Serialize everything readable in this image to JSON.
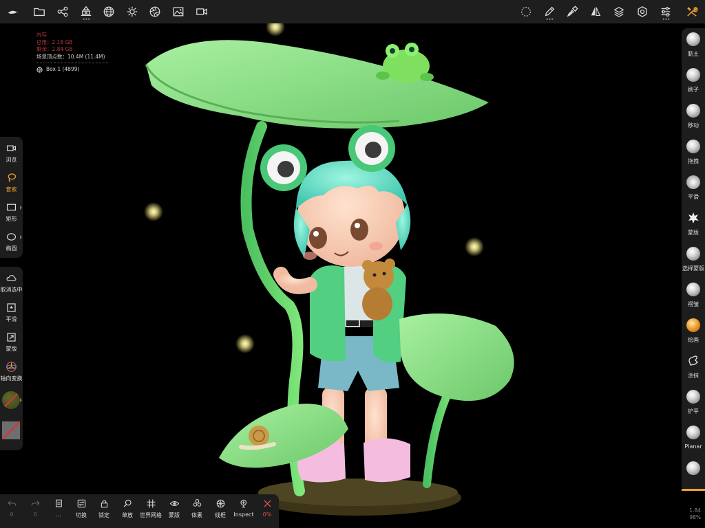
{
  "info": {
    "memory_title": "内存",
    "used": "已用：2.18 GB",
    "remaining": "剩余：2.84 GB",
    "vertices": "场景顶点数：10.4M (11.4M)",
    "selected_object": "Box 1 (4899)"
  },
  "left_tools": {
    "browse": "浏览",
    "lasso": "套索",
    "rectangle": "矩形",
    "ellipse": "椭圆",
    "deselect": "取消选中",
    "smooth": "平滑",
    "mask": "蒙版",
    "axis_transform": "轴向变换"
  },
  "right_tools": {
    "clay": "黏土",
    "brush": "刷子",
    "move": "移动",
    "drag": "拖拽",
    "smooth": "平滑",
    "mask": "蒙版",
    "select_mask": "选择蒙版",
    "crease": "褶皱",
    "paint": "绘画",
    "smudge": "涂抹",
    "flatten": "铲平",
    "planar": "Planar"
  },
  "bottom_tools": {
    "undo_count": "0",
    "redo_count": "0",
    "menu_dots": "...",
    "switch": "切换",
    "lock": "锁定",
    "solo": "单放",
    "world_grid": "世界网格",
    "mask": "蒙版",
    "voxel": "体素",
    "wireframe": "线框",
    "inspect": "Inspect",
    "percent": "0%"
  },
  "perf": {
    "line1": "1.84",
    "line2": "98%"
  },
  "colors": {
    "accent_orange": "#f0a030",
    "memory_red": "#b23a3a",
    "close_red": "#e05050",
    "panel_bg": "#1d1d1d",
    "leaf_green": "#8fe08a",
    "hair_teal": "#6fe0c8"
  }
}
